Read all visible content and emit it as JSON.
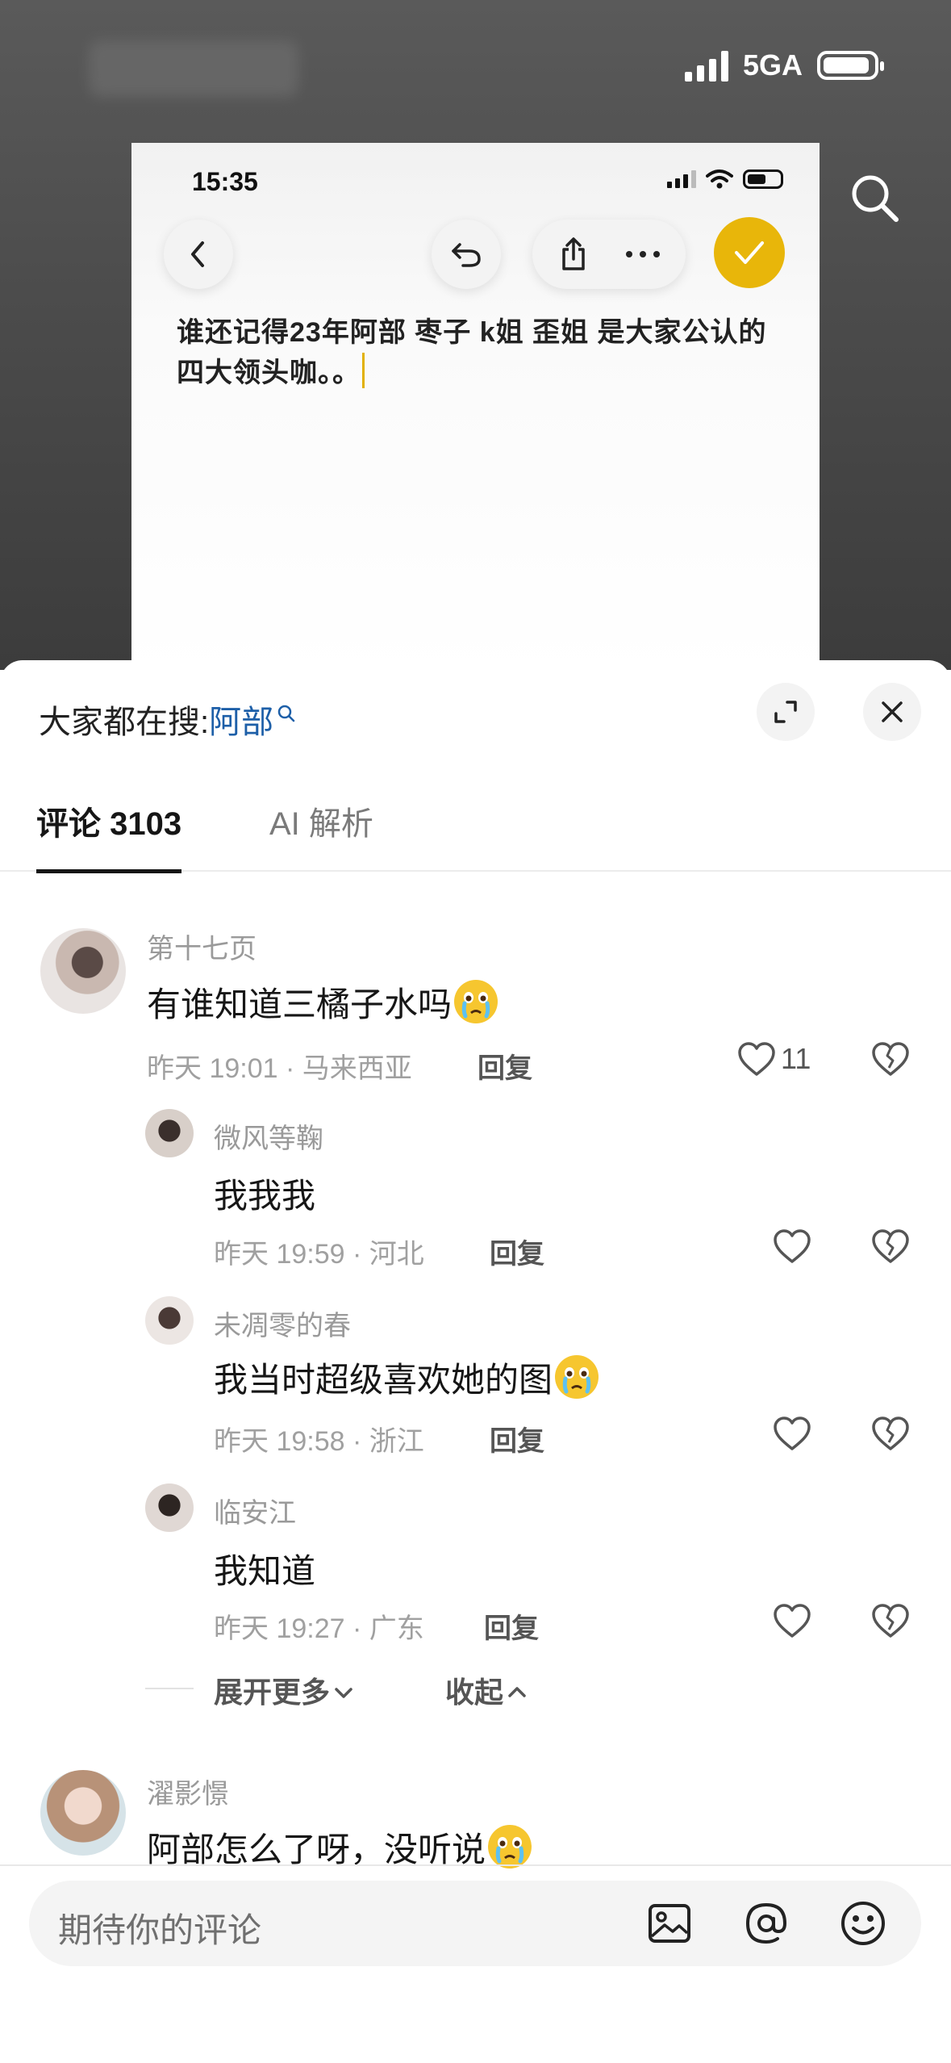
{
  "status_bar": {
    "network": "5GA"
  },
  "card": {
    "time": "15:35",
    "post_text": "谁还记得23年阿部 枣子 k姐 歪姐 是大家公认的四大领头咖。。"
  },
  "sheet": {
    "search_prefix": "大家都在搜:",
    "search_keyword": "阿部",
    "tabs": [
      {
        "label": "评论 3103",
        "active": true
      },
      {
        "label": "AI 解析",
        "active": false
      }
    ]
  },
  "comments": [
    {
      "user": "第十七页",
      "text": "有谁知道三橘子水吗",
      "meta": "昨天 19:01 · 马来西亚",
      "reply_label": "回复",
      "likes": "11"
    },
    {
      "user": "微风等鞠",
      "text": "我我我",
      "meta": "昨天 19:59 · 河北",
      "reply_label": "回复"
    },
    {
      "user": "未凋零的春",
      "text": "我当时超级喜欢她的图",
      "meta": "昨天 19:58 · 浙江",
      "reply_label": "回复"
    },
    {
      "user": "临安江",
      "text": "我知道",
      "meta": "昨天 19:27 · 广东",
      "reply_label": "回复"
    },
    {
      "user": "濯影憬",
      "text": "阿部怎么了呀，没听说"
    }
  ],
  "expand": {
    "more": "展开更多",
    "collapse": "收起"
  },
  "input": {
    "placeholder": "期待你的评论"
  },
  "colors": {
    "accent_yellow": "#e8b60a",
    "keyword_blue": "#1d5fa8"
  }
}
